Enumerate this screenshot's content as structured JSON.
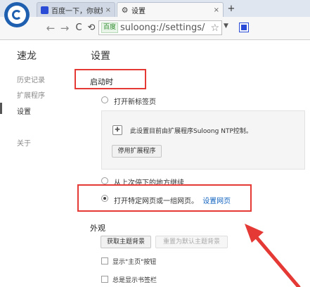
{
  "browser": {
    "tabs": [
      {
        "title": "百度一下，你就知",
        "close": "×"
      },
      {
        "title": "设置",
        "close": "×"
      }
    ],
    "new_tab": "+",
    "nav": {
      "back": "←",
      "forward": "→",
      "reload": "C",
      "undo": "⟲"
    },
    "omnibox": {
      "site_badge": "百度",
      "url": "suloong://settings/",
      "star": "☆"
    },
    "toolbar_dropdown": "▼"
  },
  "sidebar": {
    "title": "速龙",
    "items": [
      {
        "label": "历史记录"
      },
      {
        "label": "扩展程序"
      },
      {
        "label": "设置"
      },
      {
        "label": "关于"
      }
    ]
  },
  "main": {
    "title": "设置",
    "startup": {
      "heading": "启动时",
      "opt_newtab": "打开新标签页",
      "ext_notice": "此设置目前由扩展程序Suloong NTP控制。",
      "disable_ext_btn": "停用扩展程序",
      "opt_continue": "从上次停下的地方继续",
      "opt_specific": "打开特定网页或一组网页。",
      "set_pages_link": "设置网页"
    },
    "appearance": {
      "heading": "外观",
      "get_themes_btn": "获取主题背景",
      "reset_theme_btn": "重置为默认主题背景",
      "show_home_label": "显示\"主页\"按钮",
      "show_bookmarks_label": "总是显示书签栏"
    }
  },
  "colors": {
    "highlight": "#e53935",
    "link": "#1565c0"
  }
}
